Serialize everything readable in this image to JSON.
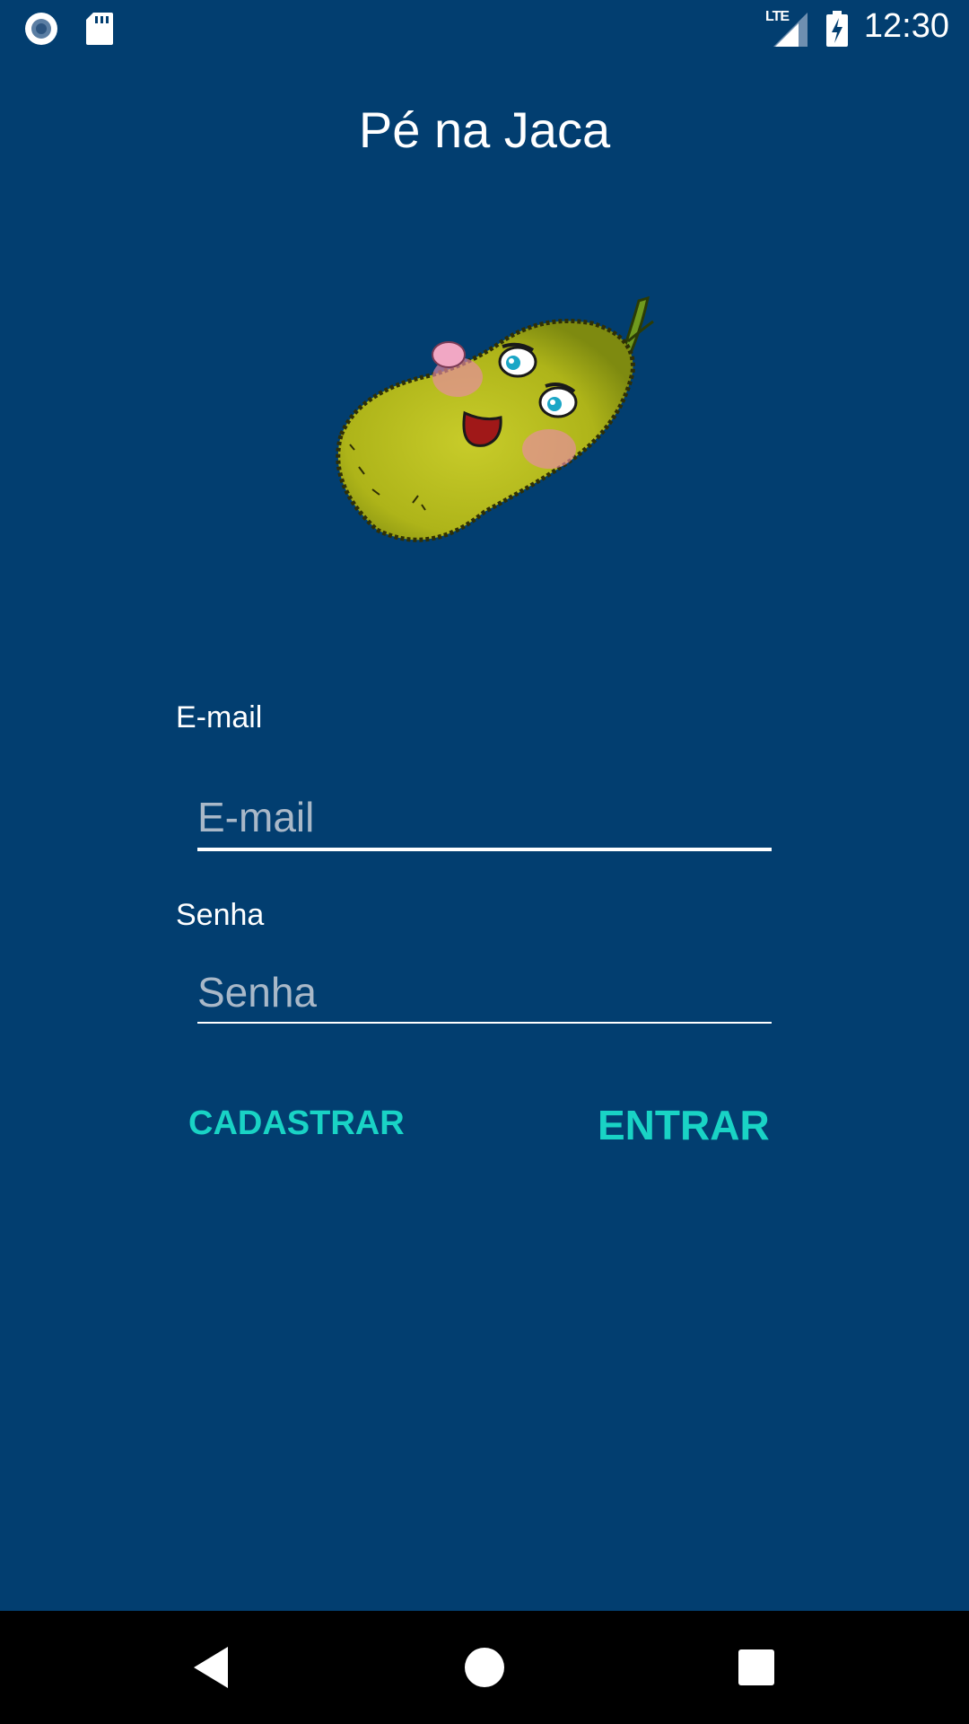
{
  "status_bar": {
    "time": "12:30",
    "network": "LTE",
    "icons": [
      "record-icon",
      "sd-card-icon",
      "signal-icon",
      "battery-charging-icon"
    ]
  },
  "app": {
    "title": "Pé na Jaca",
    "mascot": "jackfruit-mascot-illustration"
  },
  "form": {
    "email_label": "E-mail",
    "email_placeholder": "E-mail",
    "email_value": "",
    "password_label": "Senha",
    "password_placeholder": "Senha",
    "password_value": ""
  },
  "actions": {
    "register_label": "CADASTRAR",
    "login_label": "ENTRAR"
  },
  "colors": {
    "background": "#023e70",
    "accent": "#19d3c5",
    "nav_bar": "#000000"
  },
  "nav_bar": {
    "icons": [
      "back-icon",
      "home-icon",
      "recents-icon"
    ]
  }
}
